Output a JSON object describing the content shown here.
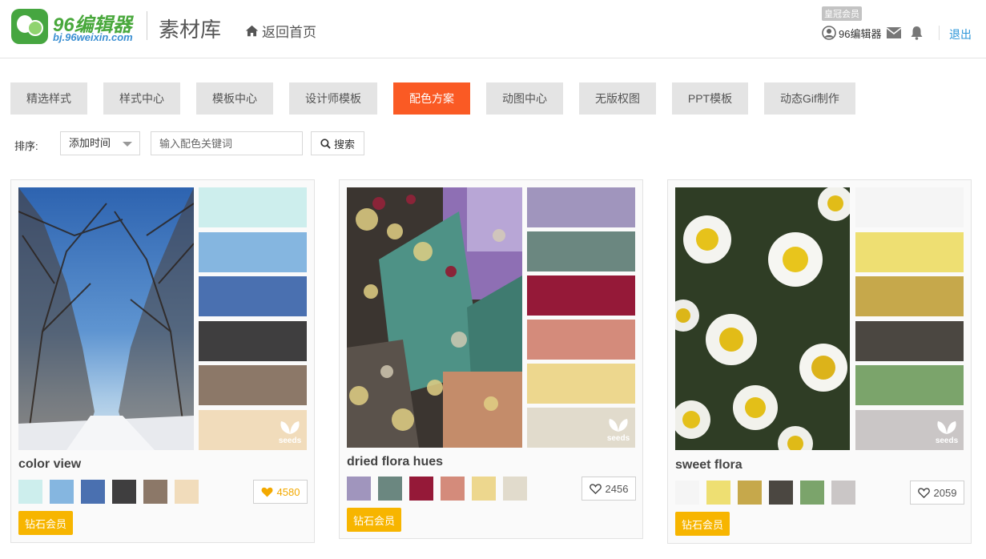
{
  "header": {
    "logo_name": "96编辑器",
    "logo_url": "bj.96weixin.com",
    "section_title": "素材库",
    "home_link": "返回首页",
    "vip_tag": "皇冠会员",
    "user_name": "96编辑器",
    "logout": "退出"
  },
  "tabs": [
    {
      "label": "精选样式",
      "active": false
    },
    {
      "label": "样式中心",
      "active": false
    },
    {
      "label": "模板中心",
      "active": false
    },
    {
      "label": "设计师模板",
      "active": false
    },
    {
      "label": "配色方案",
      "active": true
    },
    {
      "label": "动图中心",
      "active": false
    },
    {
      "label": "无版权图",
      "active": false
    },
    {
      "label": "PPT模板",
      "active": false
    },
    {
      "label": "动态Gif制作",
      "active": false
    }
  ],
  "filter": {
    "sort_label": "排序:",
    "sort_value": "添加时间",
    "search_placeholder": "输入配色关键词",
    "search_button": "搜索"
  },
  "cards": [
    {
      "name": "color view",
      "colors": [
        "#cdeeed",
        "#85b6e0",
        "#4a70b0",
        "#3f3e3f",
        "#8c7868",
        "#f1dcbb"
      ],
      "likes": "4580",
      "liked": true,
      "badge": "钻石会员",
      "watermark": "seeds"
    },
    {
      "name": "dried flora hues",
      "colors": [
        "#a095bd",
        "#6b8780",
        "#951938",
        "#d48b7b",
        "#edd78e",
        "#e1dbcc"
      ],
      "likes": "2456",
      "liked": false,
      "badge": "钻石会员",
      "watermark": "seeds"
    },
    {
      "name": "sweet flora",
      "colors": [
        "#f5f5f5",
        "#eedf72",
        "#c6a84b",
        "#4b4741",
        "#7ba46b",
        "#cac6c6"
      ],
      "likes": "2059",
      "liked": false,
      "badge": "钻石会员",
      "watermark": "seeds"
    }
  ],
  "colors": {
    "accent": "#fa5a24",
    "badge": "#f7b500",
    "link": "#2a95d8"
  }
}
